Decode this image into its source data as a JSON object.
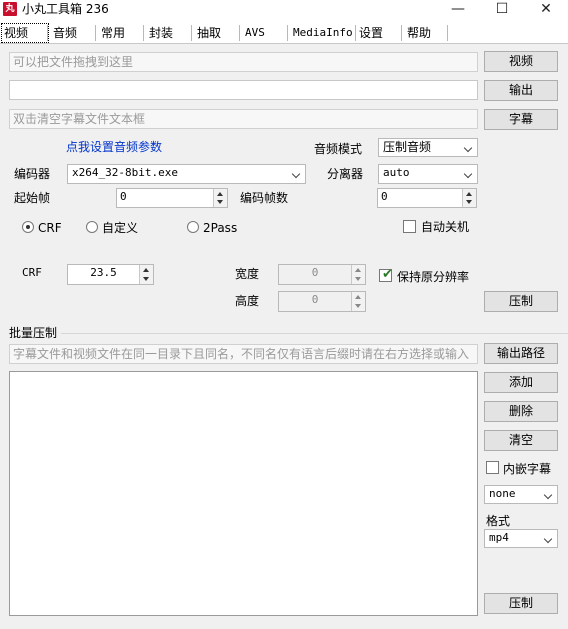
{
  "window": {
    "title": "小丸工具箱 236",
    "icon_text": "丸",
    "minimize": "—",
    "maximize": "☐",
    "close": "✕"
  },
  "tabs": [
    {
      "label": "视频",
      "active": true
    },
    {
      "label": "音频"
    },
    {
      "label": "常用"
    },
    {
      "label": "封装"
    },
    {
      "label": "抽取"
    },
    {
      "label": "AVS"
    },
    {
      "label": "MediaInfo"
    },
    {
      "label": "设置"
    },
    {
      "label": "帮助"
    }
  ],
  "inputs": {
    "video_drop_placeholder": "可以把文件拖拽到这里",
    "output_path": "",
    "subtitle_placeholder": "双击清空字幕文件文本框"
  },
  "buttons": {
    "video": "视频",
    "output": "输出",
    "subtitle": "字幕",
    "compress": "压制",
    "output_path": "输出路径",
    "add": "添加",
    "delete": "删除",
    "clear": "清空",
    "batch_compress": "压制"
  },
  "audio": {
    "settings_link": "点我设置音频参数",
    "mode_label": "音频模式",
    "mode_value": "压制音频"
  },
  "encoder": {
    "label": "编码器",
    "value": "x264_32-8bit.exe",
    "demuxer_label": "分离器",
    "demuxer_value": "auto",
    "start_frame_label": "起始帧",
    "start_frame_value": "0",
    "frame_count_label": "编码帧数",
    "frame_count_value": "0",
    "auto_shutdown_label": "自动关机",
    "auto_shutdown_checked": false
  },
  "rate_modes": [
    {
      "label": "CRF",
      "checked": true
    },
    {
      "label": "自定义",
      "checked": false
    },
    {
      "label": "2Pass",
      "checked": false
    }
  ],
  "crf": {
    "label": "CRF",
    "value": "23.5",
    "width_label": "宽度",
    "width_value": "0",
    "height_label": "高度",
    "height_value": "0",
    "keep_resolution_label": "保持原分辨率",
    "keep_resolution_checked": true
  },
  "batch": {
    "group_label": "批量压制",
    "hint_placeholder": "字幕文件和视频文件在同一目录下且同名，不同名仅有语言后缀时请在右方选择或输入",
    "file_list": [],
    "embed_subtitle_label": "内嵌字幕",
    "embed_subtitle_checked": false,
    "subtitle_lang_value": "none",
    "format_label": "格式",
    "format_value": "mp4"
  }
}
